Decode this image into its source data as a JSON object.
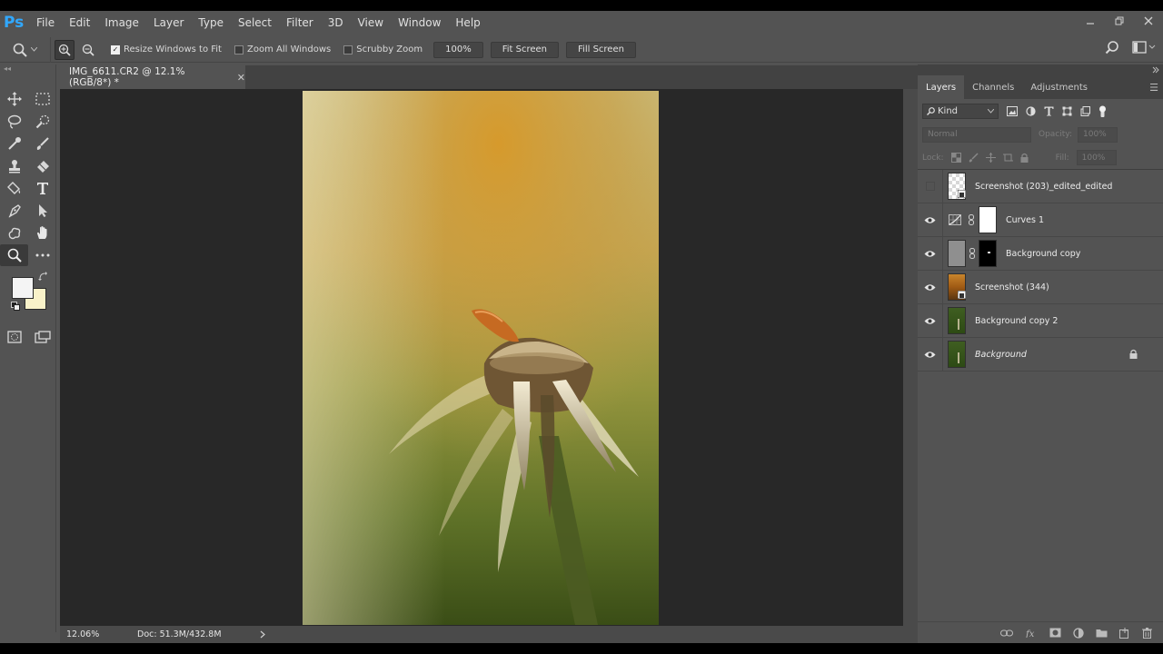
{
  "app": {
    "logo": "Ps",
    "menu": [
      "File",
      "Edit",
      "Image",
      "Layer",
      "Type",
      "Select",
      "Filter",
      "3D",
      "View",
      "Window",
      "Help"
    ]
  },
  "options": {
    "resize_windows": "Resize Windows to Fit",
    "zoom_all": "Zoom All Windows",
    "scrubby_zoom": "Scrubby Zoom",
    "zoom_value": "100%",
    "fit_screen": "Fit Screen",
    "fill_screen": "Fill Screen"
  },
  "document": {
    "tab_title": "IMG_6611.CR2 @ 12.1% (RGB/8*) *",
    "zoom_status": "12.06%",
    "doc_status": "Doc: 51.3M/432.8M"
  },
  "colors": {
    "foreground": "#f4f4f4",
    "background": "#f9f2c9"
  },
  "layers_panel": {
    "tabs": [
      "Layers",
      "Channels",
      "Adjustments"
    ],
    "filter_kind": "Kind",
    "blend_mode": "Normal",
    "opacity_label": "Opacity:",
    "opacity_value": "100%",
    "lock_label": "Lock:",
    "fill_label": "Fill:",
    "fill_value": "100%",
    "layers": [
      {
        "name": "Screenshot (203)_edited_edited",
        "visible": false
      },
      {
        "name": "Curves 1",
        "visible": true
      },
      {
        "name": "Background copy",
        "visible": true
      },
      {
        "name": "Screenshot (344)",
        "visible": true
      },
      {
        "name": "Background copy 2",
        "visible": true
      },
      {
        "name": "Background",
        "visible": true
      }
    ]
  }
}
